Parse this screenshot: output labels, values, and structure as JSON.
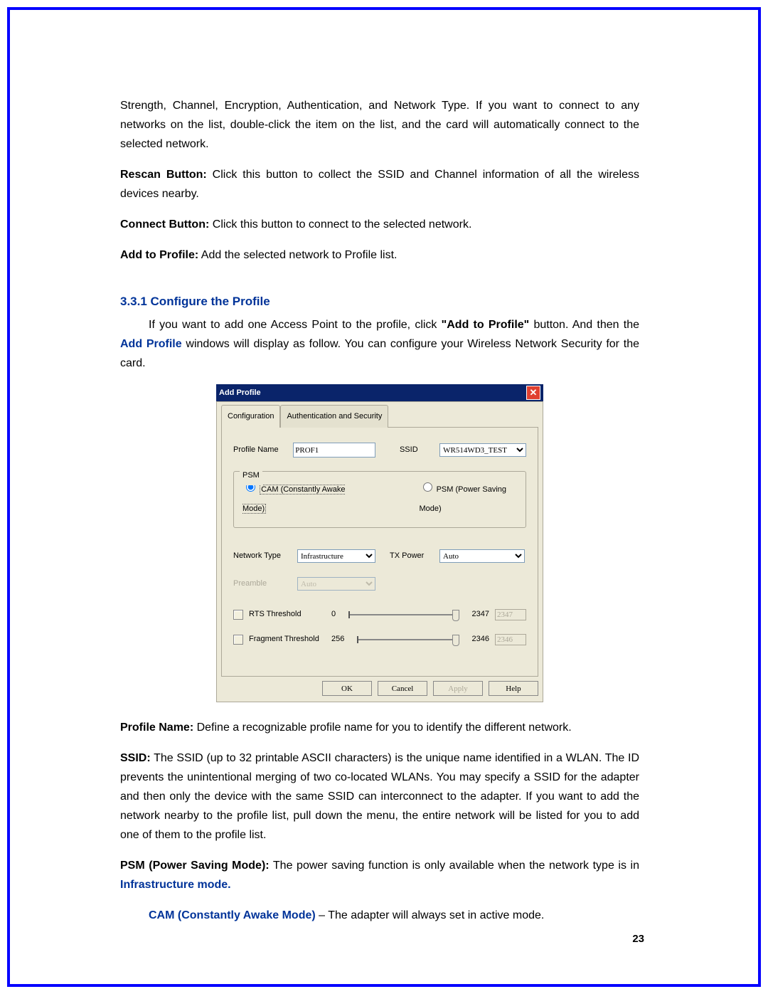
{
  "top_para": "Strength, Channel, Encryption, Authentication, and Network Type. If you want to connect to any networks on the list, double-click the item on the list, and the card will automatically connect to the selected network.",
  "rescan": {
    "label": "Rescan Button:",
    "text": " Click this button to collect the SSID and Channel information of all the wireless devices nearby."
  },
  "connect": {
    "label": "Connect Button:",
    "text": " Click this button to connect to the selected network."
  },
  "addprof": {
    "label": "Add to Profile:",
    "text": " Add the selected network to Profile list."
  },
  "heading": "3.3.1 Configure the Profile",
  "intro1_a": "If you want to add one Access Point to the profile, click ",
  "intro1_b": "\"Add to Profile\"",
  "intro1_c": " button. And then the ",
  "intro1_d": "Add Profile",
  "intro1_e": " windows will display as follow. You can configure your Wireless Network Security for the card.",
  "dialog": {
    "title": "Add Profile",
    "tabs": {
      "configuration": "Configuration",
      "auth": "Authentication and Security"
    },
    "labels": {
      "profileName": "Profile Name",
      "ssid": "SSID",
      "psm_group": "PSM",
      "cam": "CAM (Constantly Awake Mode)",
      "psm": "PSM (Power Saving Mode)",
      "netType": "Network Type",
      "txPower": "TX Power",
      "preamble": "Preamble",
      "rts": "RTS Threshold",
      "frag": "Fragment Threshold"
    },
    "values": {
      "profileName": "PROF1",
      "ssid": "WR514WD3_TEST",
      "netType": "Infrastructure",
      "txPower": "Auto",
      "preamble": "Auto",
      "rts_min": "0",
      "rts_max": "2347",
      "rts_val": "2347",
      "frag_min": "256",
      "frag_max": "2346",
      "frag_val": "2346"
    },
    "buttons": {
      "ok": "OK",
      "cancel": "Cancel",
      "apply": "Apply",
      "help": "Help"
    }
  },
  "defs": {
    "pn_label": "Profile Name:",
    "pn_text": " Define a recognizable profile name for you to identify the different network.",
    "ssid_label": "SSID:",
    "ssid_text": " The SSID (up to 32 printable ASCII characters) is the unique name identified in a WLAN. The ID prevents the unintentional merging of two co-located WLANs. You may specify a SSID for the adapter and then only the device with the same SSID can interconnect to the adapter. If you want to add the network nearby to the profile list, pull down the menu, the entire network will be listed for you to add one of them to the profile list.",
    "psm_label": "PSM (Power Saving Mode):",
    "psm_text_a": " The power saving function is only available when the network type is in ",
    "psm_text_b": "Infrastructure mode.",
    "cam_label": "CAM (Constantly Awake Mode)",
    "cam_text": " – The adapter will always set in active mode."
  },
  "pagenum": "23"
}
